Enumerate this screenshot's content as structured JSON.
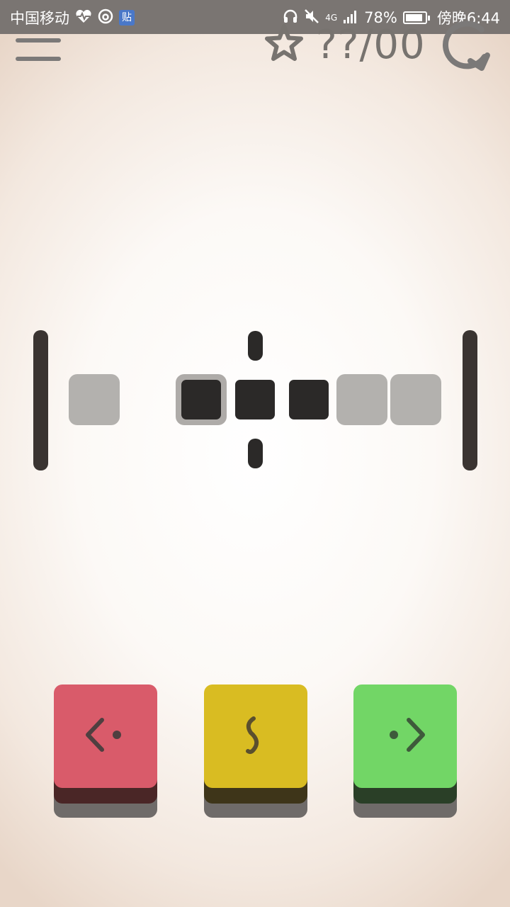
{
  "status_bar": {
    "carrier": "中国移动",
    "tieba_badge": "贴",
    "network": "4G",
    "battery": "78%",
    "time": "傍晚6:44",
    "icons": [
      "heart-pulse-icon",
      "weibo-icon",
      "headphones-icon",
      "mute-icon",
      "signal-icon",
      "battery-icon"
    ]
  },
  "header": {
    "menu_icon": "hamburger-menu-icon",
    "star_icon": "star-icon",
    "score": "??/00",
    "restart_icon": "restart-icon"
  },
  "board": {
    "cells": [
      "empty",
      "gap",
      "selected-block",
      "block",
      "block",
      "empty",
      "empty"
    ],
    "marker_between": "selected-block|block"
  },
  "controls": [
    {
      "id": "left",
      "icon": "move-left-icon",
      "color": "#d95b6a",
      "side_color": "#4a2626"
    },
    {
      "id": "swap",
      "icon": "swap-s-icon",
      "color": "#d9bc22",
      "side_color": "#3e3519"
    },
    {
      "id": "right",
      "icon": "move-right-icon",
      "color": "#72d666",
      "side_color": "#2a3f27"
    }
  ]
}
